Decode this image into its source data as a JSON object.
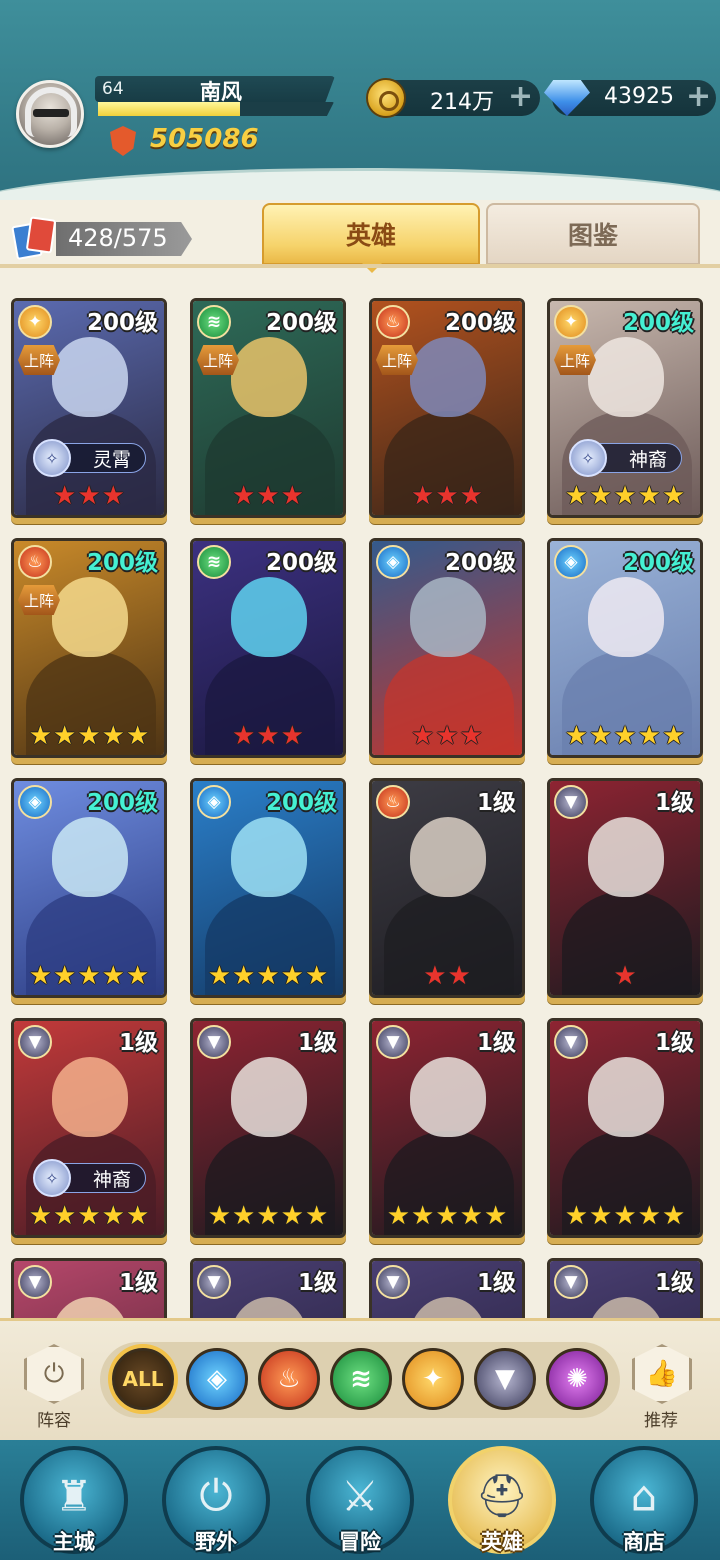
{
  "player": {
    "level": "64",
    "name": "南风",
    "exp_progress": 0.6,
    "power": "505086"
  },
  "resources": {
    "gold": "214万",
    "gems": "43925",
    "plus": "+"
  },
  "collection": {
    "count": "428/575"
  },
  "tabs": [
    {
      "label": "英雄",
      "active": true
    },
    {
      "label": "图鉴",
      "active": false
    }
  ],
  "labels": {
    "on_team": "上阵"
  },
  "heroes": [
    {
      "level": "200级",
      "level_color": "white",
      "element": "light",
      "on_team": true,
      "badge": "灵霄",
      "stars": 3,
      "star_color": "red",
      "palette": [
        "#5b6bb0",
        "#c9d6f0",
        "#2b2a44"
      ]
    },
    {
      "level": "200级",
      "level_color": "white",
      "element": "wind",
      "on_team": true,
      "badge": "",
      "stars": 3,
      "star_color": "red",
      "palette": [
        "#2e6a58",
        "#e9c36a",
        "#1e3a30"
      ]
    },
    {
      "level": "200级",
      "level_color": "white",
      "element": "fire",
      "on_team": true,
      "badge": "",
      "stars": 3,
      "star_color": "red",
      "palette": [
        "#b2521f",
        "#7f88b8",
        "#3a2518"
      ]
    },
    {
      "level": "200级",
      "level_color": "teal",
      "element": "light",
      "on_team": true,
      "badge": "神裔",
      "stars": 5,
      "star_color": "gold",
      "palette": [
        "#c8b8ae",
        "#efe6e0",
        "#6c5a58"
      ]
    },
    {
      "level": "200级",
      "level_color": "teal",
      "element": "fire",
      "on_team": true,
      "badge": "",
      "stars": 5,
      "star_color": "gold",
      "palette": [
        "#c98a2a",
        "#f5d98c",
        "#4e3414"
      ]
    },
    {
      "level": "200级",
      "level_color": "white",
      "element": "wind",
      "on_team": false,
      "badge": "",
      "stars": 3,
      "star_color": "red",
      "palette": [
        "#3c3180",
        "#5fd2f0",
        "#1b1840"
      ]
    },
    {
      "level": "200级",
      "level_color": "white",
      "element": "water",
      "on_team": false,
      "badge": "",
      "stars": 3,
      "star_color": "red",
      "palette": [
        "#345a8c",
        "#a8b6c4",
        "#c4352c"
      ]
    },
    {
      "level": "200级",
      "level_color": "teal",
      "element": "water",
      "on_team": false,
      "badge": "",
      "stars": 5,
      "star_color": "gold",
      "palette": [
        "#9ab3d8",
        "#eeeaf2",
        "#6a7fae"
      ]
    },
    {
      "level": "200级",
      "level_color": "teal",
      "element": "water",
      "on_team": false,
      "badge": "",
      "stars": 5,
      "star_color": "gold",
      "palette": [
        "#6f8de0",
        "#c9e7f5",
        "#2c3c82"
      ]
    },
    {
      "level": "200级",
      "level_color": "teal",
      "element": "water",
      "on_team": false,
      "badge": "",
      "stars": 5,
      "star_color": "gold",
      "palette": [
        "#2b7fc9",
        "#9ee0f5",
        "#143a66"
      ]
    },
    {
      "level": "1级",
      "level_color": "white",
      "element": "fire",
      "on_team": false,
      "badge": "",
      "stars": 2,
      "star_color": "red",
      "palette": [
        "#3d3c44",
        "#d9cfc4",
        "#1e1d22"
      ]
    },
    {
      "level": "1级",
      "level_color": "white",
      "element": "dark",
      "on_team": false,
      "badge": "",
      "stars": 1,
      "star_color": "red",
      "palette": [
        "#8e2432",
        "#e8e0dc",
        "#1c1a1f"
      ]
    },
    {
      "level": "1级",
      "level_color": "white",
      "element": "dark",
      "on_team": false,
      "badge": "神裔",
      "stars": 5,
      "star_color": "gold",
      "palette": [
        "#c23a3a",
        "#f4b08c",
        "#4a1c26"
      ]
    },
    {
      "level": "1级",
      "level_color": "white",
      "element": "dark",
      "on_team": false,
      "badge": "",
      "stars": 5,
      "star_color": "gold",
      "palette": [
        "#8e2432",
        "#e8e0dc",
        "#1c1a1f"
      ]
    },
    {
      "level": "1级",
      "level_color": "white",
      "element": "dark",
      "on_team": false,
      "badge": "",
      "stars": 5,
      "star_color": "gold",
      "palette": [
        "#8e2432",
        "#e8e0dc",
        "#1c1a1f"
      ]
    },
    {
      "level": "1级",
      "level_color": "white",
      "element": "dark",
      "on_team": false,
      "badge": "",
      "stars": 5,
      "star_color": "gold",
      "palette": [
        "#8e2432",
        "#e8e0dc",
        "#1c1a1f"
      ]
    },
    {
      "level": "1级",
      "level_color": "white",
      "element": "dark",
      "on_team": false,
      "badge": "",
      "stars": 0,
      "star_color": "gold",
      "palette": [
        "#b5476a",
        "#f0d0b0",
        "#4a2030"
      ]
    },
    {
      "level": "1级",
      "level_color": "white",
      "element": "dark",
      "on_team": false,
      "badge": "",
      "stars": 0,
      "star_color": "gold",
      "palette": [
        "#4a3f72",
        "#c9b8a8",
        "#1e1a33"
      ]
    },
    {
      "level": "1级",
      "level_color": "white",
      "element": "dark",
      "on_team": false,
      "badge": "",
      "stars": 0,
      "star_color": "gold",
      "palette": [
        "#4a3f72",
        "#c9b8a8",
        "#1e1a33"
      ]
    },
    {
      "level": "1级",
      "level_color": "white",
      "element": "dark",
      "on_team": false,
      "badge": "",
      "stars": 0,
      "star_color": "gold",
      "palette": [
        "#4a3f72",
        "#c9b8a8",
        "#1e1a33"
      ]
    }
  ],
  "filters": {
    "left_label": "阵容",
    "right_label": "推荐",
    "items": [
      {
        "name": "all",
        "label": "ALL",
        "active": true
      },
      {
        "name": "water",
        "label": "",
        "active": false
      },
      {
        "name": "fire",
        "label": "",
        "active": false
      },
      {
        "name": "wind",
        "label": "",
        "active": false
      },
      {
        "name": "light",
        "label": "",
        "active": false
      },
      {
        "name": "dark",
        "label": "",
        "active": false
      },
      {
        "name": "void",
        "label": "",
        "active": false
      }
    ]
  },
  "nav": [
    {
      "label": "主城",
      "icon": "castle-icon",
      "active": false
    },
    {
      "label": "野外",
      "icon": "portal-icon",
      "active": false
    },
    {
      "label": "冒险",
      "icon": "sword-icon",
      "active": false
    },
    {
      "label": "英雄",
      "icon": "helmet-icon",
      "active": true
    },
    {
      "label": "商店",
      "icon": "shop-icon",
      "active": false
    }
  ]
}
